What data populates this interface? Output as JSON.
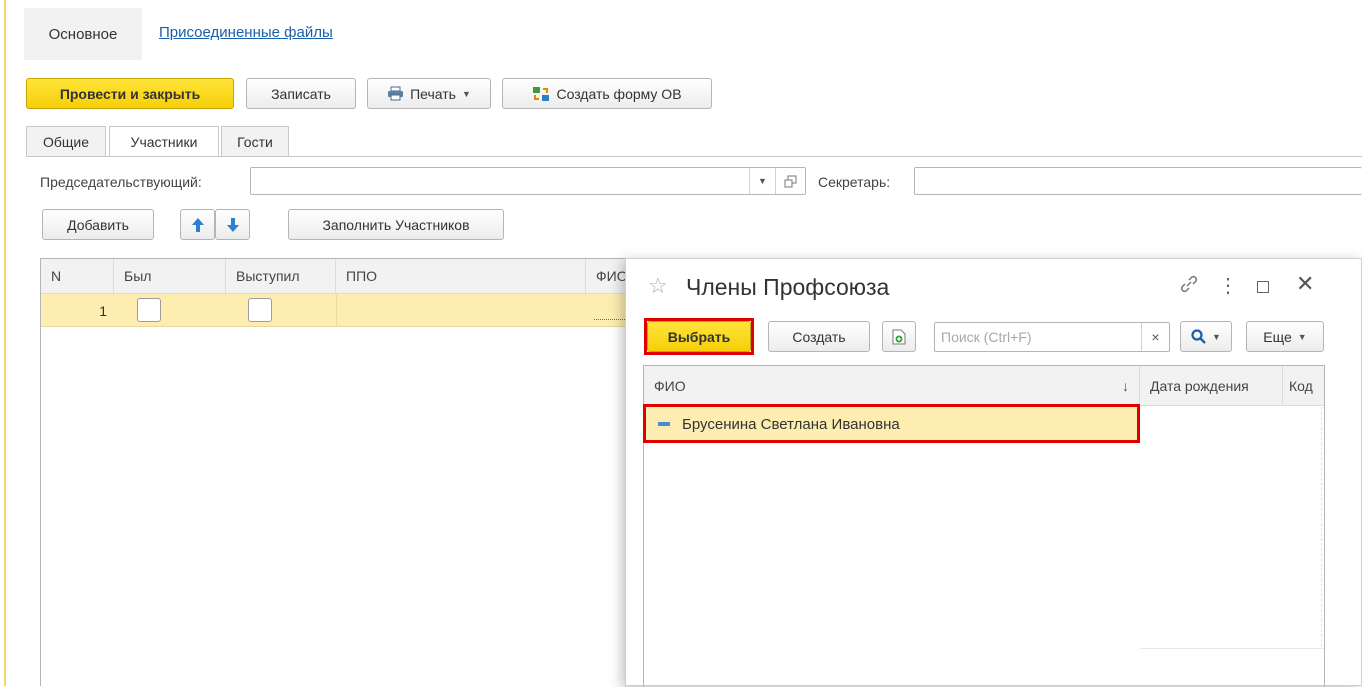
{
  "top_tabs": {
    "main": "Основное",
    "attached_files": "Присоединенные файлы"
  },
  "toolbar": {
    "post_close": "Провести и закрыть",
    "save": "Записать",
    "print": "Печать",
    "create_form": "Создать форму ОВ"
  },
  "form_tabs": [
    "Общие",
    "Участники",
    "Гости"
  ],
  "fields": {
    "chairman_label": "Председательствующий:",
    "secretary_label": "Секретарь:"
  },
  "participants_toolbar": {
    "add": "Добавить",
    "fill": "Заполнить Участников"
  },
  "participants_table": {
    "columns": [
      "N",
      "Был",
      "Выступил",
      "ППО",
      "ФИО"
    ],
    "rows": [
      {
        "n": "1",
        "was": false,
        "spoke": false,
        "ppo": "",
        "fio": ""
      }
    ]
  },
  "popup": {
    "title": "Члены Профсоюза",
    "select": "Выбрать",
    "create": "Создать",
    "search_placeholder": "Поиск (Ctrl+F)",
    "clear": "×",
    "more": "Еще",
    "columns": [
      "ФИО",
      "Дата рождения",
      "Код"
    ],
    "sort_indicator": "↓",
    "rows": [
      "Брусенина Светлана Ивановна"
    ]
  },
  "colors": {
    "accent_yellow": "#f6cf08",
    "selection_row": "#fdedb1",
    "highlight_red": "#e00000",
    "link_blue": "#1a5faa"
  }
}
